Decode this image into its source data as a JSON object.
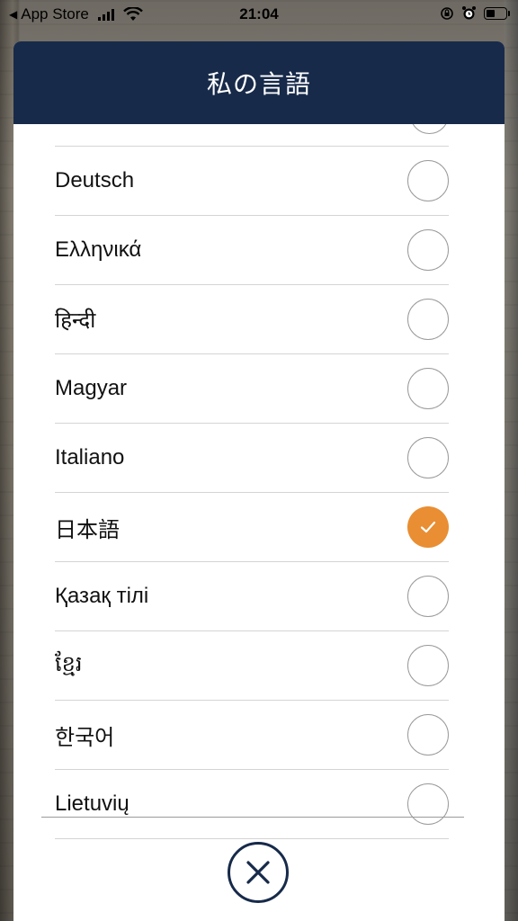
{
  "status_bar": {
    "back_app": "App Store",
    "time": "21:04"
  },
  "modal": {
    "title": "私の言語",
    "selected_language": "日本語",
    "languages": [
      {
        "label": "Deutsch",
        "selected": false
      },
      {
        "label": "Ελληνικά",
        "selected": false
      },
      {
        "label": "हिन्दी",
        "selected": false
      },
      {
        "label": "Magyar",
        "selected": false
      },
      {
        "label": "Italiano",
        "selected": false
      },
      {
        "label": "日本語",
        "selected": true
      },
      {
        "label": "Қазақ тілі",
        "selected": false
      },
      {
        "label": "ខ្មែរ",
        "selected": false
      },
      {
        "label": "한국어",
        "selected": false
      },
      {
        "label": "Lietuvių",
        "selected": false
      }
    ]
  },
  "colors": {
    "header_bg": "#172a4a",
    "accent": "#e98e33"
  },
  "icons": {
    "check": "check-icon",
    "close": "close-icon"
  }
}
